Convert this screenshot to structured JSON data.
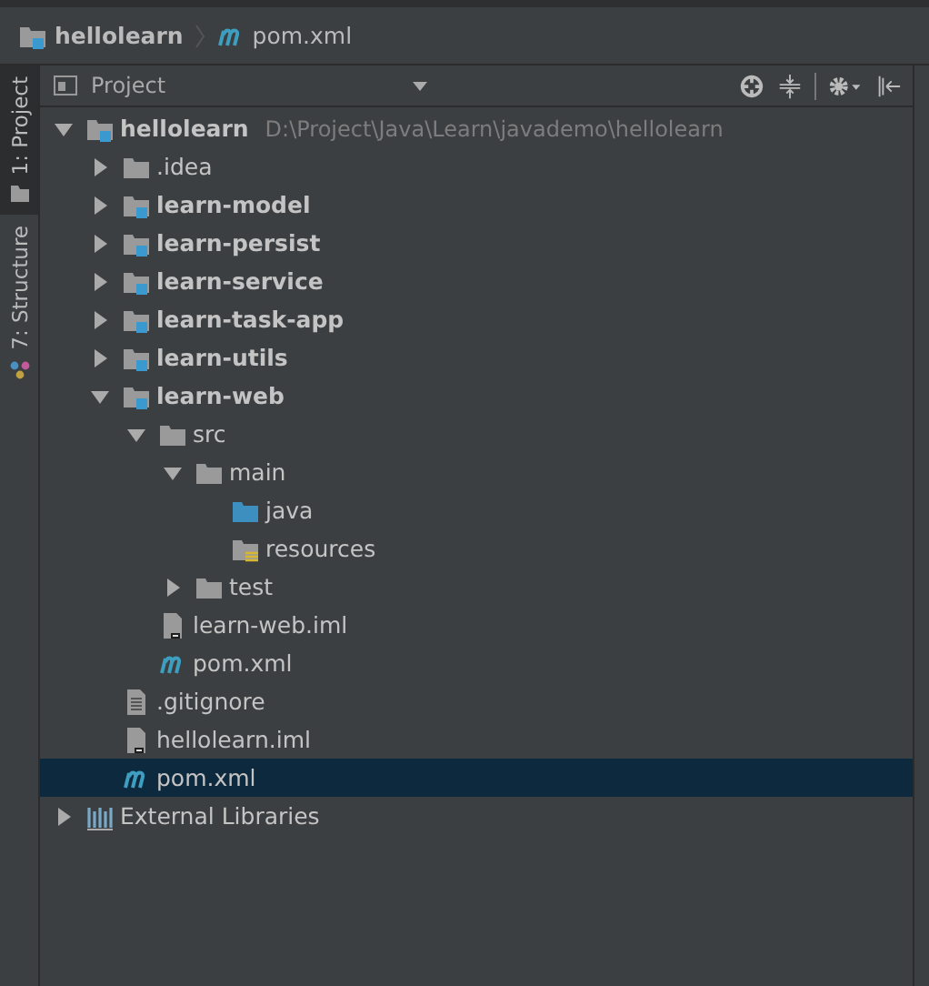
{
  "breadcrumb": [
    {
      "label": "hellolearn",
      "kind": "module"
    },
    {
      "label": "pom.xml",
      "kind": "maven"
    }
  ],
  "tool_tabs": [
    {
      "label": "1: Project",
      "kind": "project",
      "selected": true
    },
    {
      "label": "7: Structure",
      "kind": "structure",
      "selected": false
    }
  ],
  "panel": {
    "title": "Project"
  },
  "tree": [
    {
      "label": "hellolearn",
      "path": "D:\\Project\\Java\\Learn\\javademo\\hellolearn",
      "kind": "module",
      "expanded": true,
      "selected": false,
      "children": [
        {
          "label": ".idea",
          "kind": "folder",
          "expanded": false,
          "selected": false
        },
        {
          "label": "learn-model",
          "kind": "module",
          "expanded": false,
          "selected": false
        },
        {
          "label": "learn-persist",
          "kind": "module",
          "expanded": false,
          "selected": false
        },
        {
          "label": "learn-service",
          "kind": "module",
          "expanded": false,
          "selected": false
        },
        {
          "label": "learn-task-app",
          "kind": "module",
          "expanded": false,
          "selected": false
        },
        {
          "label": "learn-utils",
          "kind": "module",
          "expanded": false,
          "selected": false
        },
        {
          "label": "learn-web",
          "kind": "module",
          "expanded": true,
          "selected": false,
          "children": [
            {
              "label": "src",
              "kind": "folder",
              "expanded": true,
              "selected": false,
              "children": [
                {
                  "label": "main",
                  "kind": "folder",
                  "expanded": true,
                  "selected": false,
                  "children": [
                    {
                      "label": "java",
                      "kind": "source",
                      "selected": false
                    },
                    {
                      "label": "resources",
                      "kind": "resources",
                      "selected": false
                    }
                  ]
                },
                {
                  "label": "test",
                  "kind": "folder",
                  "expanded": false,
                  "selected": false
                }
              ]
            },
            {
              "label": "learn-web.iml",
              "kind": "iml",
              "selected": false
            },
            {
              "label": "pom.xml",
              "kind": "maven",
              "selected": false
            }
          ]
        },
        {
          "label": ".gitignore",
          "kind": "text",
          "selected": false
        },
        {
          "label": "hellolearn.iml",
          "kind": "iml",
          "selected": false
        },
        {
          "label": "pom.xml",
          "kind": "maven",
          "selected": true
        }
      ]
    },
    {
      "label": "External Libraries",
      "kind": "libraries",
      "expanded": false,
      "selected": false
    }
  ]
}
